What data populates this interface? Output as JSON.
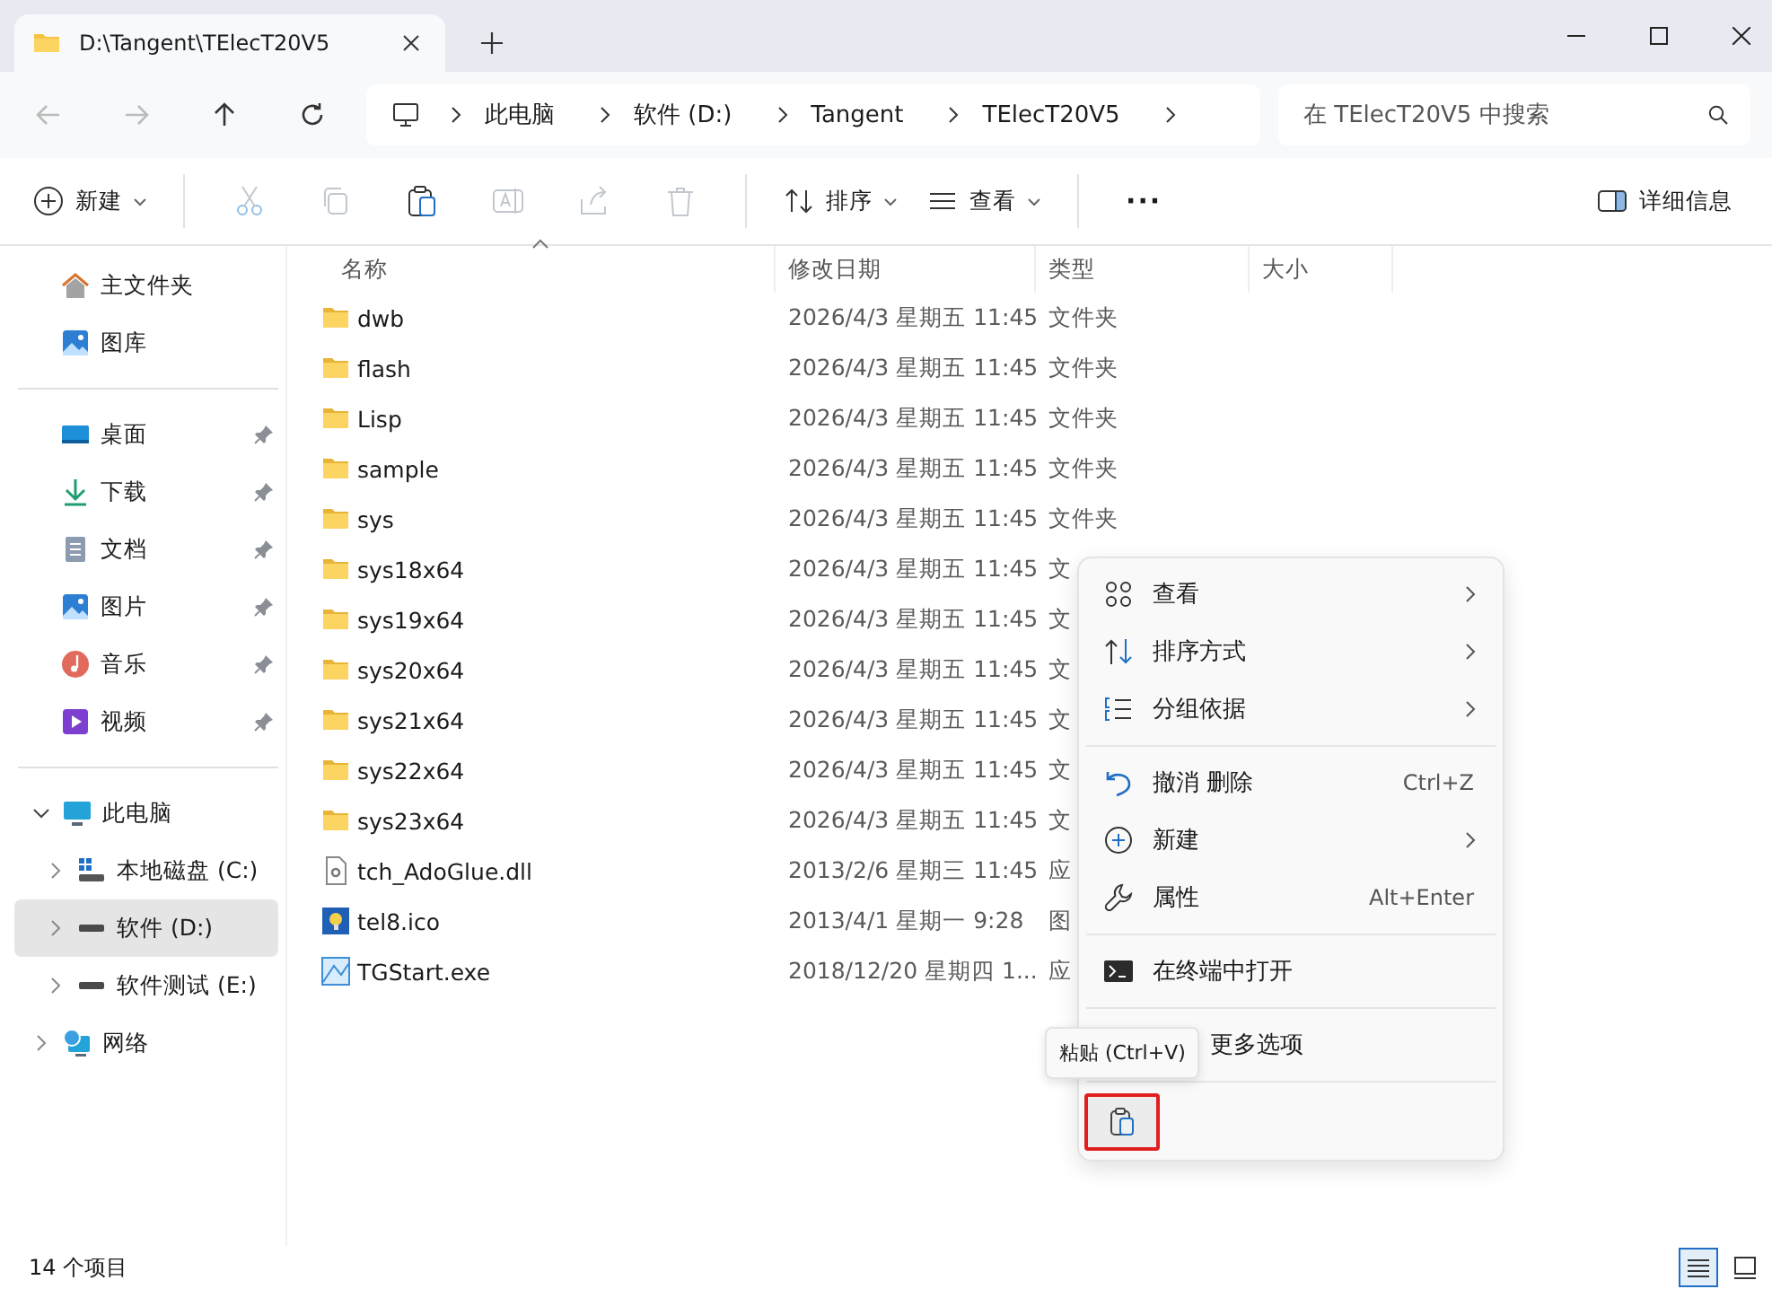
{
  "window": {
    "tab_title": "D:\\Tangent\\TElecT20V5"
  },
  "address_bar": {
    "crumbs": [
      "此电脑",
      "软件 (D:)",
      "Tangent",
      "TElecT20V5"
    ],
    "search": {
      "placeholder": "在 TElecT20V5 中搜索"
    }
  },
  "toolbar": {
    "new_label": "新建",
    "actions": [
      {
        "kind": "cut",
        "disabled": true
      },
      {
        "kind": "copy",
        "disabled": true
      },
      {
        "kind": "paste",
        "disabled": false
      },
      {
        "kind": "rename",
        "disabled": true
      },
      {
        "kind": "share",
        "disabled": true
      },
      {
        "kind": "delete",
        "disabled": true
      }
    ],
    "sort_label": "排序",
    "view_label": "查看",
    "more_label": "···",
    "details_label": "详细信息"
  },
  "sidebar": {
    "top": [
      {
        "label": "主文件夹",
        "kind": "home"
      },
      {
        "label": "图库",
        "kind": "gallery"
      }
    ],
    "pinned": [
      {
        "label": "桌面",
        "kind": "desktop",
        "pinned": true
      },
      {
        "label": "下载",
        "kind": "download",
        "pinned": true
      },
      {
        "label": "文档",
        "kind": "documents",
        "pinned": true
      },
      {
        "label": "图片",
        "kind": "pictures",
        "pinned": true
      },
      {
        "label": "音乐",
        "kind": "music",
        "pinned": true
      },
      {
        "label": "视频",
        "kind": "video",
        "pinned": true
      }
    ],
    "tree": [
      {
        "label": "此电脑",
        "kind": "pc",
        "expanded": true,
        "selected": false,
        "children": [
          {
            "label": "本地磁盘 (C:)",
            "kind": "sysdrive",
            "expanded": false,
            "selected": false
          },
          {
            "label": "软件 (D:)",
            "kind": "drive",
            "expanded": false,
            "selected": true
          },
          {
            "label": "软件测试 (E:)",
            "kind": "drive",
            "expanded": false,
            "selected": false
          }
        ]
      },
      {
        "label": "网络",
        "kind": "network",
        "expanded": false,
        "selected": false
      }
    ]
  },
  "table": {
    "columns": [
      {
        "label": "名称",
        "sorted": true
      },
      {
        "label": "修改日期",
        "sorted": false
      },
      {
        "label": "类型",
        "sorted": false
      },
      {
        "label": "大小",
        "sorted": false
      }
    ],
    "rows": [
      {
        "name": "dwb",
        "kind": "folder",
        "date": "2026/4/3 星期五 11:45",
        "type": "文件夹"
      },
      {
        "name": "flash",
        "kind": "folder",
        "date": "2026/4/3 星期五 11:45",
        "type": "文件夹"
      },
      {
        "name": "Lisp",
        "kind": "folder",
        "date": "2026/4/3 星期五 11:45",
        "type": "文件夹"
      },
      {
        "name": "sample",
        "kind": "folder",
        "date": "2026/4/3 星期五 11:45",
        "type": "文件夹"
      },
      {
        "name": "sys",
        "kind": "folder",
        "date": "2026/4/3 星期五 11:45",
        "type": "文件夹"
      },
      {
        "name": "sys18x64",
        "kind": "folder",
        "date": "2026/4/3 星期五 11:45",
        "type": "文"
      },
      {
        "name": "sys19x64",
        "kind": "folder",
        "date": "2026/4/3 星期五 11:45",
        "type": "文"
      },
      {
        "name": "sys20x64",
        "kind": "folder",
        "date": "2026/4/3 星期五 11:45",
        "type": "文"
      },
      {
        "name": "sys21x64",
        "kind": "folder",
        "date": "2026/4/3 星期五 11:45",
        "type": "文"
      },
      {
        "name": "sys22x64",
        "kind": "folder",
        "date": "2026/4/3 星期五 11:45",
        "type": "文"
      },
      {
        "name": "sys23x64",
        "kind": "folder",
        "date": "2026/4/3 星期五 11:45",
        "type": "文"
      },
      {
        "name": "tch_AdoGlue.dll",
        "kind": "dll",
        "date": "2013/2/6 星期三 11:45",
        "type": "应"
      },
      {
        "name": "tel8.ico",
        "kind": "ico",
        "date": "2013/4/1 星期一 9:28",
        "type": "图"
      },
      {
        "name": "TGStart.exe",
        "kind": "exe",
        "date": "2018/12/20 星期四 1...",
        "type": "应"
      }
    ]
  },
  "context_menu": {
    "groups": [
      [
        {
          "label": "查看",
          "kind": "view",
          "submenu": true
        },
        {
          "label": "排序方式",
          "kind": "sort",
          "submenu": true
        },
        {
          "label": "分组依据",
          "kind": "group",
          "submenu": true
        }
      ],
      [
        {
          "label": "撤消 删除",
          "kind": "undo",
          "shortcut": "Ctrl+Z",
          "submenu": false
        },
        {
          "label": "新建",
          "kind": "new",
          "submenu": true
        },
        {
          "label": "属性",
          "kind": "properties",
          "shortcut": "Alt+Enter",
          "submenu": false
        }
      ],
      [
        {
          "label": "在终端中打开",
          "kind": "terminal",
          "submenu": false
        }
      ],
      [
        {
          "label": "更多选项",
          "kind": "more",
          "submenu": false
        }
      ]
    ],
    "paste_button": {
      "highlighted": true
    },
    "tooltip": "粘贴 (Ctrl+V)"
  },
  "status_bar": {
    "count": "14 个项目",
    "views": [
      {
        "kind": "details",
        "selected": true
      },
      {
        "kind": "tiles",
        "selected": false
      }
    ]
  }
}
